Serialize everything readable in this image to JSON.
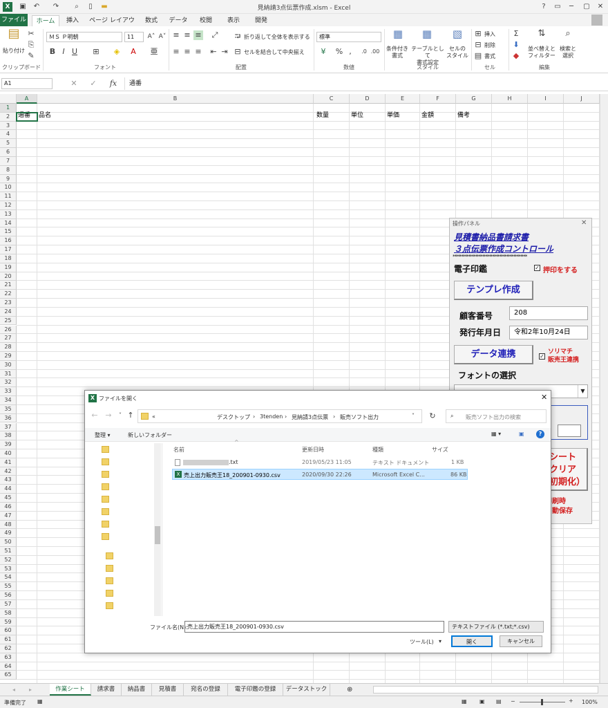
{
  "window": {
    "title": "見納請3点伝票作成.xlsm - Excel"
  },
  "tabs": [
    "ファイル",
    "ホーム",
    "挿入",
    "ページ レイアウト",
    "数式",
    "データ",
    "校閲",
    "表示",
    "開発"
  ],
  "ribbon": {
    "clipboard": {
      "paste": "貼り付け",
      "group": "クリップボード"
    },
    "font": {
      "name": "ＭＳ Ｐ明朝",
      "size": "11",
      "group": "フォント",
      "bold": "B",
      "italic": "I",
      "underline": "U"
    },
    "alignment": {
      "wrap": "折り返して全体を表示する",
      "merge": "セルを結合して中央揃え",
      "group": "配置"
    },
    "number": {
      "format": "標準",
      "group": "数値"
    },
    "styles": {
      "conditional": "条件付き\n書式",
      "table": "テーブルとして\n書式設定",
      "cell": "セルの\nスタイル",
      "group": "スタイル"
    },
    "cells": {
      "insert": "挿入",
      "delete": "削除",
      "format": "書式",
      "group": "セル"
    },
    "editing": {
      "sort": "並べ替えと\nフィルター",
      "find": "検索と\n選択",
      "group": "編集"
    }
  },
  "formula_bar": {
    "name_box": "A1",
    "fx": "fx",
    "value": "通番"
  },
  "columns": [
    "A",
    "B",
    "C",
    "D",
    "E",
    "F",
    "G",
    "H",
    "I",
    "J"
  ],
  "header_row": {
    "a": "通番",
    "b": "品名",
    "c": "数量",
    "d": "単位",
    "e": "単価",
    "f": "金額",
    "g": "備考"
  },
  "sheets": [
    "作業シート",
    "請求書",
    "納品書",
    "見積書",
    "宛名の登録",
    "電子印鑑の登録",
    "データストック"
  ],
  "status": {
    "ready": "準備完了",
    "zoom": "100%"
  },
  "panel": {
    "title": "操作パネル",
    "heading1": "見積書納品書請求書",
    "heading2": "３点伝票作成コントロール",
    "stars": "*******************************************",
    "seal_label": "電子印鑑",
    "stamp_check": "押印をする",
    "template_btn": "テンプレ作成",
    "customer_label": "顧客番号",
    "customer_value": "208",
    "date_label": "発行年月日",
    "date_value": "令和2年10月24日",
    "data_btn": "データ連携",
    "sorimachi": "ソリマチ\n販売王連携",
    "font_label": "フォントの選択",
    "clear_btn": "シート\nクリア\n（初期化）",
    "print_note": "印刷時\n自動保存"
  },
  "dialog": {
    "title": "ファイルを開く",
    "breadcrumb": [
      "デスクトップ",
      "3tenden",
      "見納請3点伝票",
      "販売ソフト出力"
    ],
    "search_placeholder": "販売ソフト出力の検索",
    "organize": "整理 ▾",
    "new_folder": "新しいフォルダー",
    "headers": [
      "名前",
      "更新日時",
      "種類",
      "サイズ"
    ],
    "files": [
      {
        "name": ".txt",
        "date": "2019/05/23 11:05",
        "type": "テキスト ドキュメント",
        "size": "1 KB"
      },
      {
        "name": "売上出力販売王18_200901-0930.csv",
        "date": "2020/09/30 22:26",
        "type": "Microsoft Excel C...",
        "size": "86 KB"
      }
    ],
    "filename_label": "ファイル名(N):",
    "filename_value": "売上出力販売王18_200901-0930.csv",
    "filter": "テキストファイル (*.txt;*.csv)",
    "tools": "ツール(L)",
    "open": "開く",
    "cancel": "キャンセル"
  }
}
